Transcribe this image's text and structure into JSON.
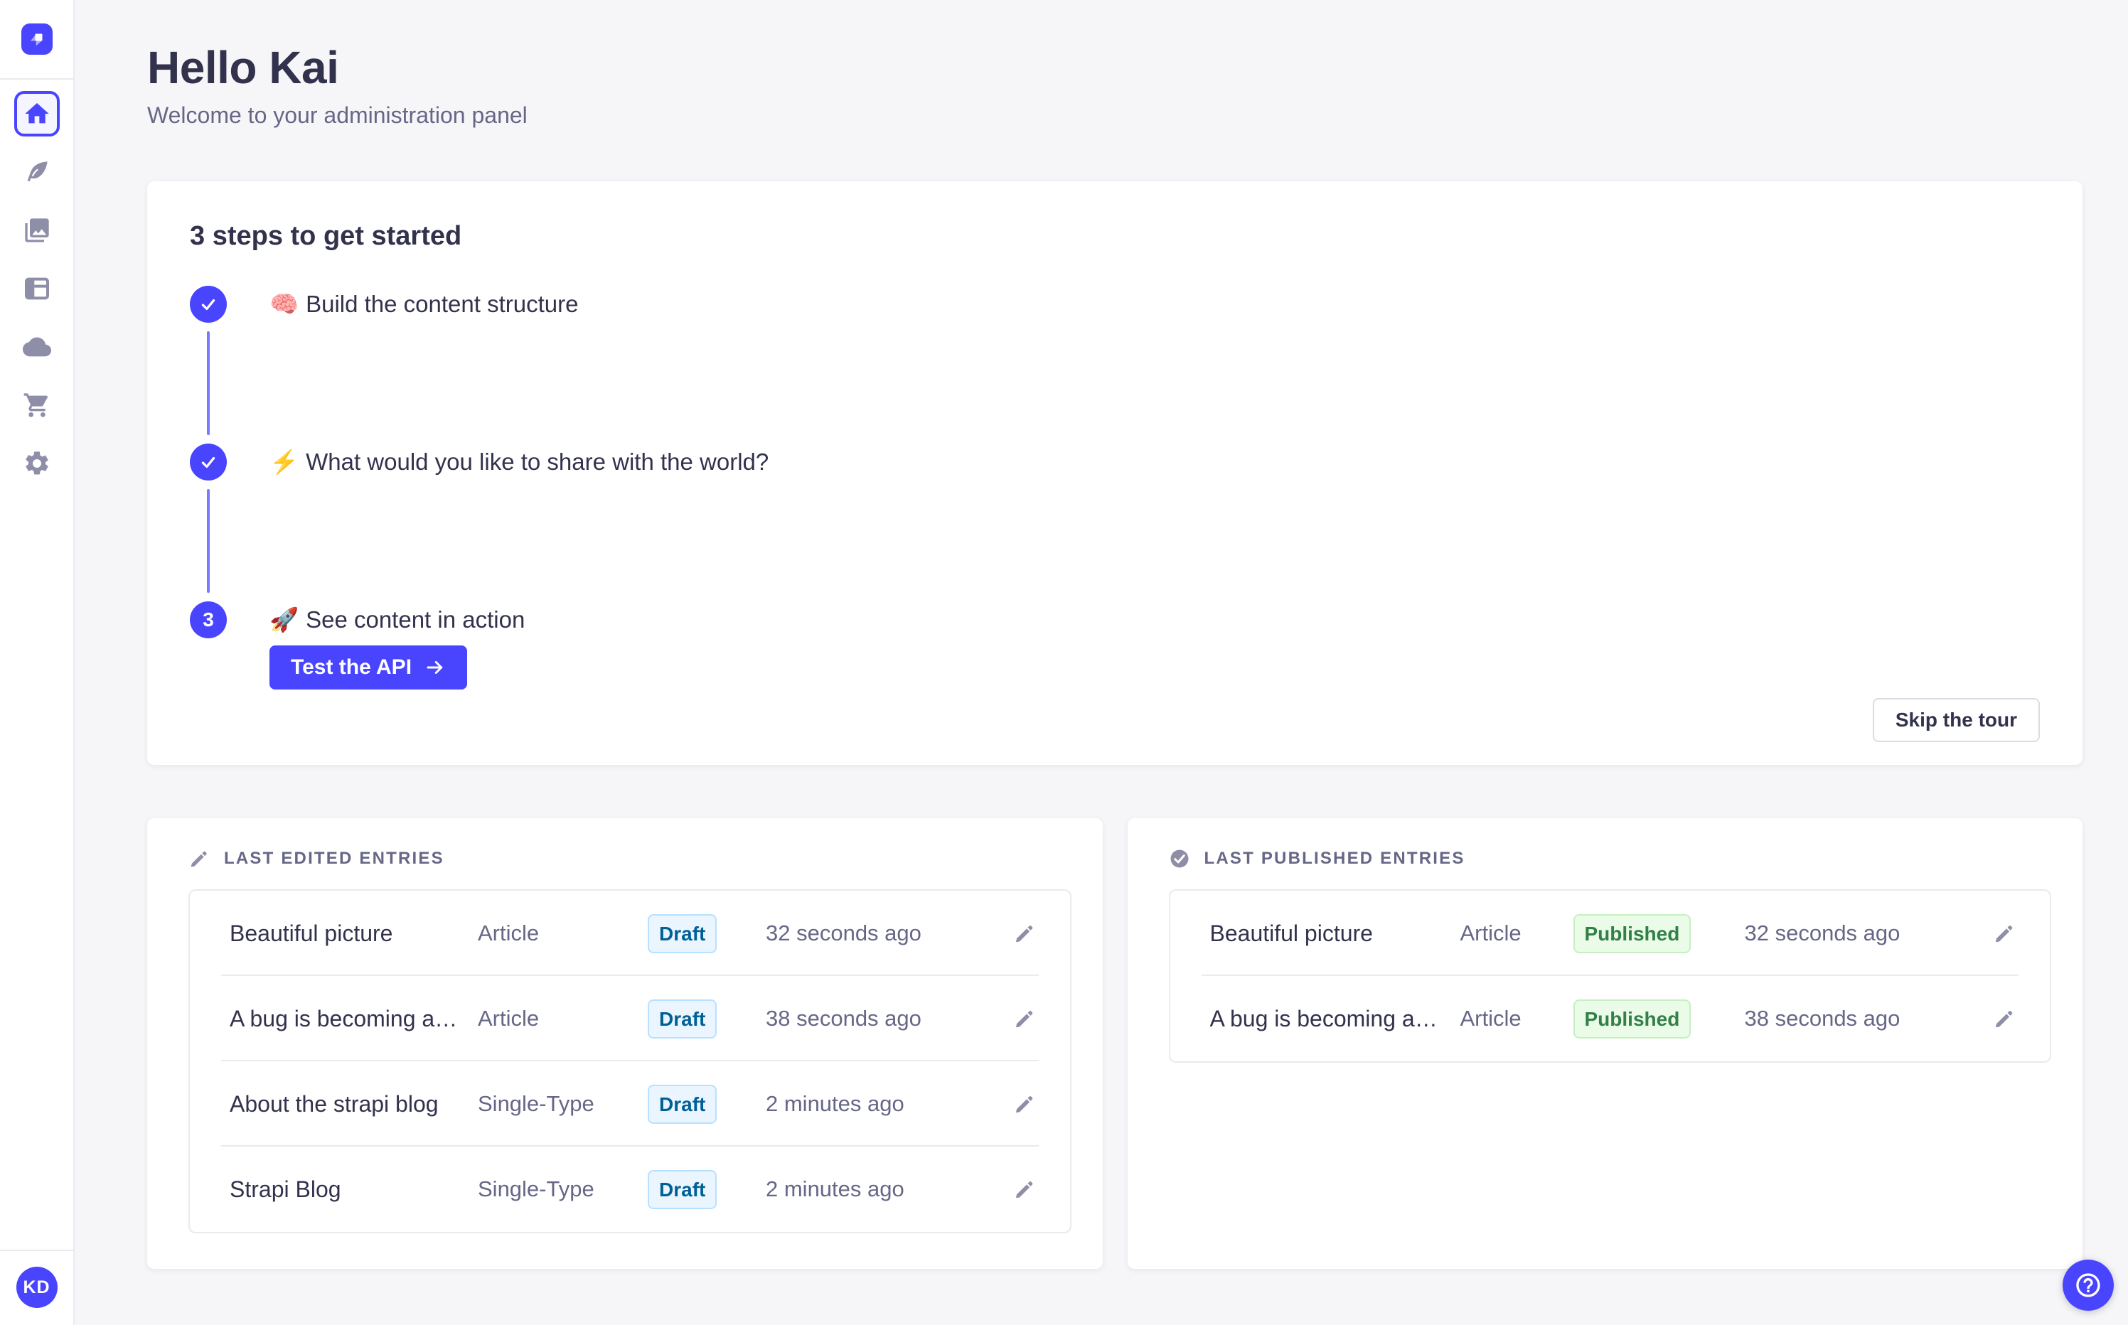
{
  "colors": {
    "accent": "#4945ff",
    "connector": "#7b79ff",
    "page_bg": "#f6f6f9",
    "border": "#eaeaef",
    "text": "#32324d",
    "text_muted": "#666687",
    "icon_gray": "#8e8ea9",
    "draft_bg": "#eaf5ff",
    "draft_border": "#b8e1ff",
    "draft_text": "#006096",
    "published_bg": "#eafbe7",
    "published_border": "#c6f0c2",
    "published_text": "#328048"
  },
  "sidebar": {
    "logo_icon": "strapi-logo",
    "items": [
      {
        "icon": "home-icon",
        "active": true
      },
      {
        "icon": "feather-icon",
        "active": false
      },
      {
        "icon": "pictures-icon",
        "active": false
      },
      {
        "icon": "layout-icon",
        "active": false
      },
      {
        "icon": "cloud-icon",
        "active": false
      },
      {
        "icon": "cart-icon",
        "active": false
      },
      {
        "icon": "gear-icon",
        "active": false
      }
    ],
    "avatar_initials": "KD"
  },
  "header": {
    "title": "Hello Kai",
    "subtitle": "Welcome to your administration panel"
  },
  "onboarding": {
    "title": "3 steps to get started",
    "steps": [
      {
        "emoji": "🧠",
        "label": "Build the content structure",
        "state": "done"
      },
      {
        "emoji": "⚡",
        "label": "What would you like to share with the world?",
        "state": "done"
      },
      {
        "emoji": "🚀",
        "label": "See content in action",
        "state": "active",
        "number": "3"
      }
    ],
    "cta_label": "Test the API",
    "skip_label": "Skip the tour"
  },
  "last_edited": {
    "header": "LAST EDITED ENTRIES",
    "rows": [
      {
        "title": "Beautiful picture",
        "type": "Article",
        "status": "Draft",
        "time": "32 seconds ago"
      },
      {
        "title": "A bug is becoming a…",
        "type": "Article",
        "status": "Draft",
        "time": "38 seconds ago"
      },
      {
        "title": "About the strapi blog",
        "type": "Single-Type",
        "status": "Draft",
        "time": "2 minutes ago"
      },
      {
        "title": "Strapi Blog",
        "type": "Single-Type",
        "status": "Draft",
        "time": "2 minutes ago"
      }
    ]
  },
  "last_published": {
    "header": "LAST PUBLISHED ENTRIES",
    "rows": [
      {
        "title": "Beautiful picture",
        "type": "Article",
        "status": "Published",
        "time": "32 seconds ago"
      },
      {
        "title": "A bug is becoming a…",
        "type": "Article",
        "status": "Published",
        "time": "38 seconds ago"
      }
    ]
  }
}
